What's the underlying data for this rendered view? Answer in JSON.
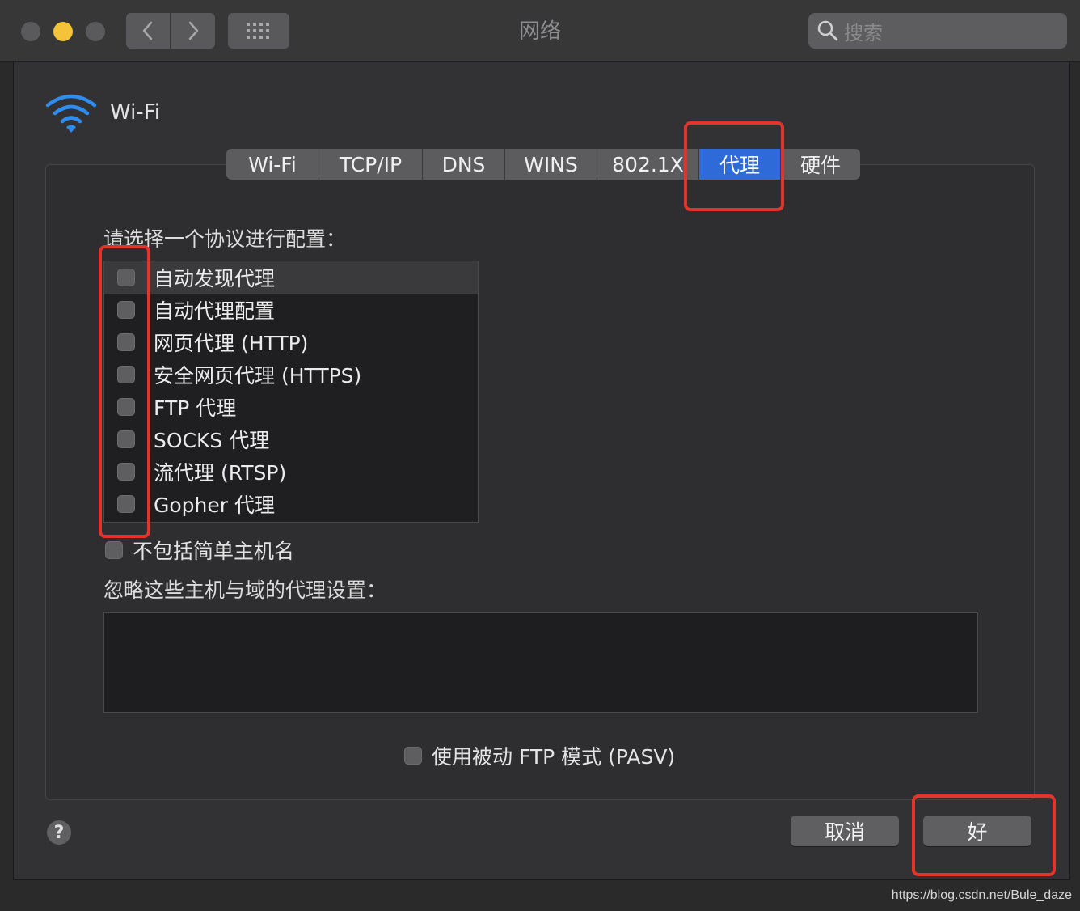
{
  "window": {
    "title": "网络",
    "search_placeholder": "搜索"
  },
  "interface": {
    "name": "Wi-Fi"
  },
  "tabs": [
    {
      "label": "Wi-Fi"
    },
    {
      "label": "TCP/IP"
    },
    {
      "label": "DNS"
    },
    {
      "label": "WINS"
    },
    {
      "label": "802.1X"
    },
    {
      "label": "代理",
      "active": true
    },
    {
      "label": "硬件"
    }
  ],
  "proxy": {
    "select_protocol_label": "请选择一个协议进行配置：",
    "protocols": [
      {
        "label": "自动发现代理",
        "checked": false
      },
      {
        "label": "自动代理配置",
        "checked": false
      },
      {
        "label": "网页代理 (HTTP)",
        "checked": false
      },
      {
        "label": "安全网页代理 (HTTPS)",
        "checked": false
      },
      {
        "label": "FTP 代理",
        "checked": false
      },
      {
        "label": "SOCKS 代理",
        "checked": false
      },
      {
        "label": "流代理 (RTSP)",
        "checked": false
      },
      {
        "label": "Gopher 代理",
        "checked": false
      }
    ],
    "exclude_simple_hostnames": {
      "label": "不包括简单主机名",
      "checked": false
    },
    "bypass_label": "忽略这些主机与域的代理设置：",
    "bypass_value": "",
    "passive_ftp": {
      "label": "使用被动 FTP 模式 (PASV)",
      "checked": false
    }
  },
  "footer": {
    "help": "?",
    "cancel_label": "取消",
    "ok_label": "好"
  },
  "watermark": "https://blog.csdn.net/Bule_daze",
  "colors": {
    "active_tab": "#2f6bd8",
    "annotation": "#e2342b"
  }
}
